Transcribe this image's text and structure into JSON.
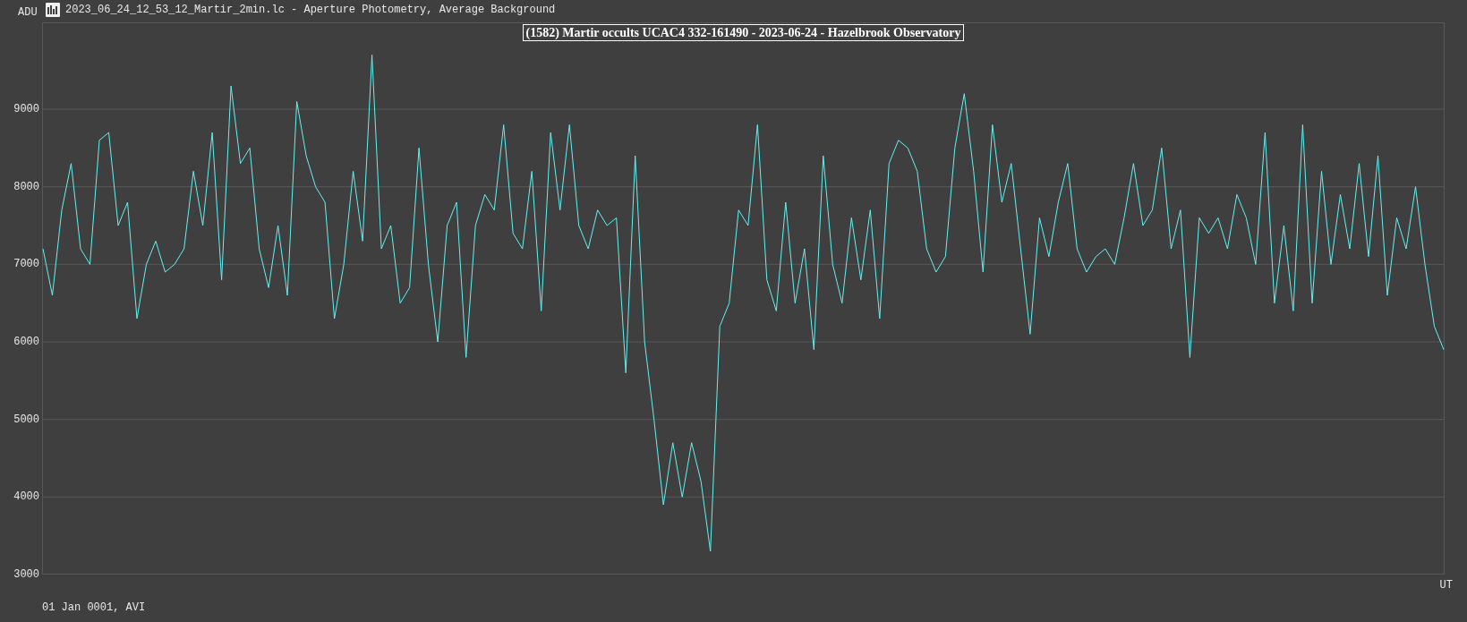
{
  "window": {
    "title": "2023_06_24_12_53_12_Martir_2min.lc - Aperture Photometry, Average Background"
  },
  "chart": {
    "chart_data": {
      "type": "line",
      "title": "(1582) Martir occults UCAC4 332-161490 - 2023-06-24 - Hazelbrook Observatory",
      "xlabel": "UT",
      "ylabel": "ADU",
      "ylim": [
        3000,
        10120
      ],
      "grid": true,
      "yticks": [
        3000,
        4000,
        5000,
        6000,
        7000,
        8000,
        9000
      ],
      "series": [
        {
          "color": "#63f2f2",
          "values": [
            7200,
            6600,
            7700,
            8300,
            7200,
            7000,
            8600,
            8700,
            7500,
            7800,
            6300,
            7000,
            7300,
            6900,
            7000,
            7200,
            8200,
            7500,
            8700,
            6800,
            9300,
            8300,
            8500,
            7200,
            6700,
            7500,
            6600,
            9100,
            8400,
            8000,
            7800,
            6300,
            7000,
            8200,
            7300,
            9700,
            7200,
            7500,
            6500,
            6700,
            8500,
            7000,
            6000,
            7500,
            7800,
            5800,
            7500,
            7900,
            7700,
            8800,
            7400,
            7200,
            8200,
            6400,
            8700,
            7700,
            8800,
            7500,
            7200,
            7700,
            7500,
            7600,
            5600,
            8400,
            6000,
            5000,
            3900,
            4700,
            4000,
            4700,
            4200,
            3300,
            6200,
            6500,
            7700,
            7500,
            8800,
            6800,
            6400,
            7800,
            6500,
            7200,
            5900,
            8400,
            7000,
            6500,
            7600,
            6800,
            7700,
            6300,
            8300,
            8600,
            8500,
            8200,
            7200,
            6900,
            7100,
            8500,
            9200,
            8200,
            6900,
            8800,
            7800,
            8300,
            7200,
            6100,
            7600,
            7100,
            7800,
            8300,
            7200,
            6900,
            7100,
            7200,
            7000,
            7600,
            8300,
            7500,
            7700,
            8500,
            7200,
            7700,
            5800,
            7600,
            7400,
            7600,
            7200,
            7900,
            7600,
            7000,
            8700,
            6500,
            7500,
            6400,
            8800,
            6500,
            8200,
            7000,
            7900,
            7200,
            8300,
            7100,
            8400,
            6600,
            7600,
            7200,
            8000,
            7000,
            6200,
            5900
          ]
        }
      ]
    }
  },
  "footer": "01 Jan 0001, AVI"
}
